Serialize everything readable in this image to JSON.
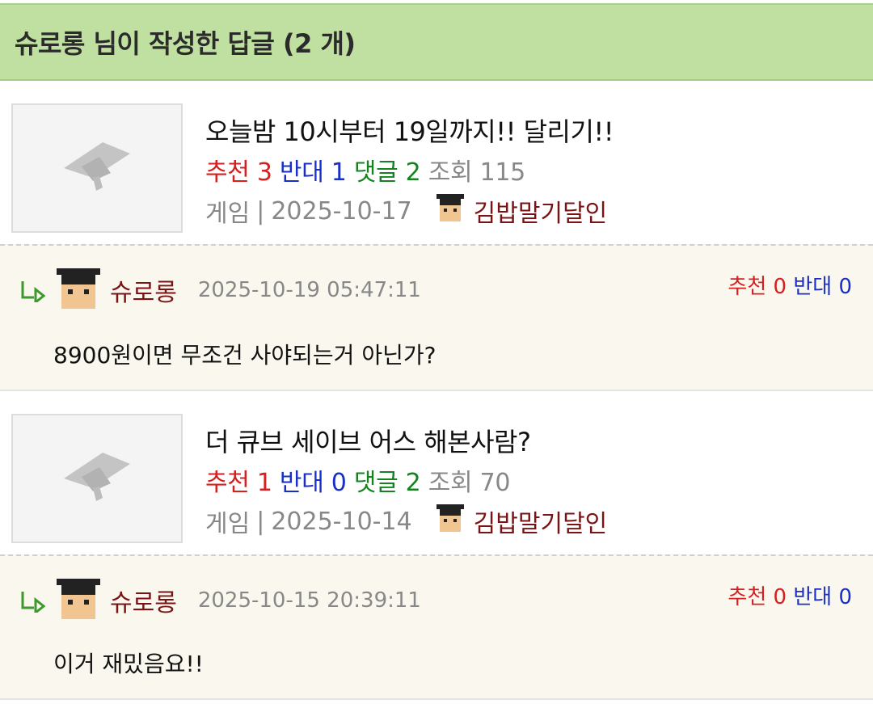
{
  "header": {
    "title": "슈로롱 님이 작성한 답글 (2 개)"
  },
  "posts": [
    {
      "title": "오늘밤 10시부터 19일까지!! 달리기!!",
      "recommend_label": "추천",
      "recommend": "3",
      "oppose_label": "반대",
      "oppose": "1",
      "comment_label": "댓글",
      "comments": "2",
      "view_label": "조회",
      "views": "115",
      "category": "게임",
      "separator": "|",
      "date": "2025-10-17",
      "author": "김밥말기달인",
      "reply": {
        "name": "슈로롱",
        "time": "2025-10-19 05:47:11",
        "recommend_label": "추천",
        "recommend": "0",
        "oppose_label": "반대",
        "oppose": "0",
        "text": "8900원이면 무조건 사야되는거 아닌가?"
      }
    },
    {
      "title": "더 큐브 세이브 어스 해본사람?",
      "recommend_label": "추천",
      "recommend": "1",
      "oppose_label": "반대",
      "oppose": "0",
      "comment_label": "댓글",
      "comments": "2",
      "view_label": "조회",
      "views": "70",
      "category": "게임",
      "separator": "|",
      "date": "2025-10-14",
      "author": "김밥말기달인",
      "reply": {
        "name": "슈로롱",
        "time": "2025-10-15 20:39:11",
        "recommend_label": "추천",
        "recommend": "0",
        "oppose_label": "반대",
        "oppose": "0",
        "text": "이거 재밌음요!!"
      }
    }
  ],
  "colors": {
    "header_bg": "#bfe0a0",
    "recommend": "#d42020",
    "oppose": "#1a2fc8",
    "comments": "#16811f",
    "author": "#7a1414",
    "reply_bg": "#faf7ee"
  },
  "icons": {
    "thumbnail": "graduation-cap-icon",
    "reply_arrow": "reply-arrow-icon",
    "avatar": "student-avatar-icon"
  }
}
